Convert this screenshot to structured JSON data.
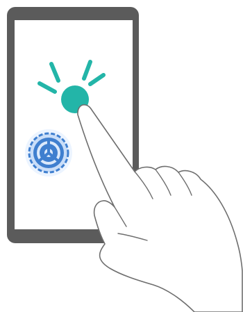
{
  "illustration": {
    "colors": {
      "device_frame": "#5b5b5b",
      "screen": "#ffffff",
      "tap_indicator": "#23b5a8",
      "gear_badge_blue": "#3f7fcf",
      "gear_badge_light": "#dbe9fb",
      "hand_outline": "#6e6e6e",
      "hand_fill": "#ffffff"
    },
    "icons": [
      "tap-indicator-icon",
      "gear-badge-icon",
      "hand-pointer-icon"
    ]
  }
}
